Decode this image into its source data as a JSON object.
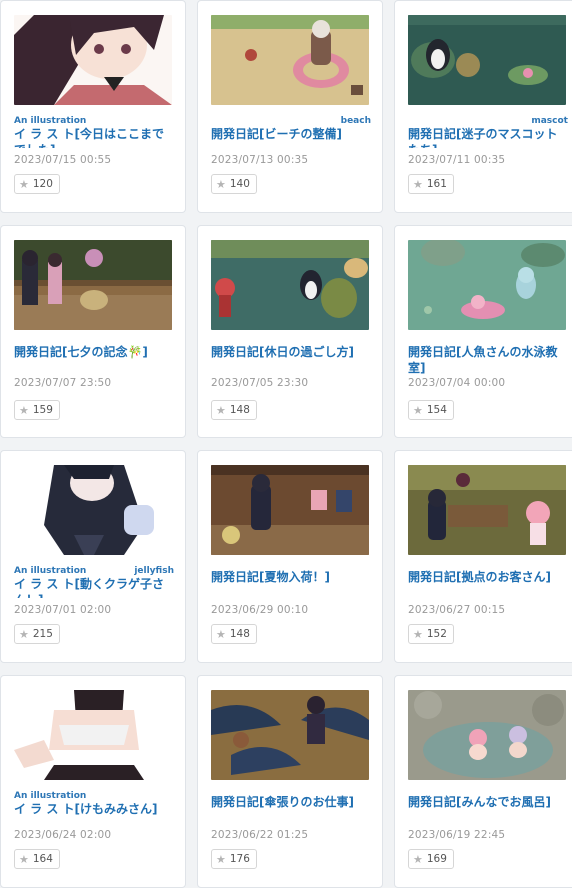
{
  "cards": [
    {
      "subtitle_left": "An illustration",
      "subtitle_right": "",
      "title": "イ ラ ス ト[今日はここまででした]",
      "date": "2023/07/15 00:55",
      "likes": "120",
      "thumb": "girl-portrait"
    },
    {
      "subtitle_left": "",
      "subtitle_right": "beach",
      "title": "開発日記[ビーチの整備]",
      "date": "2023/07/13 00:35",
      "likes": "140",
      "thumb": "beach"
    },
    {
      "subtitle_left": "",
      "subtitle_right": "mascot",
      "title": "開発日記[迷子のマスコットたち]",
      "date": "2023/07/11 00:35",
      "likes": "161",
      "thumb": "pond-mascot"
    },
    {
      "subtitle_left": "",
      "subtitle_right": "",
      "title": "開発日記[七夕の記念🎋]",
      "date": "2023/07/07 23:50",
      "likes": "159",
      "thumb": "tanabata"
    },
    {
      "subtitle_left": "",
      "subtitle_right": "",
      "title": "開発日記[休日の過ごし方]",
      "date": "2023/07/05 23:30",
      "likes": "148",
      "thumb": "holiday"
    },
    {
      "subtitle_left": "",
      "subtitle_right": "",
      "title": "開発日記[人魚さんの水泳教室]",
      "date": "2023/07/04 00:00",
      "likes": "154",
      "thumb": "mermaid"
    },
    {
      "subtitle_left": "An illustration",
      "subtitle_right": "jellyfish",
      "title": "イ ラ ス ト[動くクラゲ子さん！]",
      "date": "2023/07/01 02:00",
      "likes": "215",
      "thumb": "jellyfish"
    },
    {
      "subtitle_left": "",
      "subtitle_right": "",
      "title": "開発日記[夏物入荷！]",
      "date": "2023/06/29 00:10",
      "likes": "148",
      "thumb": "shop"
    },
    {
      "subtitle_left": "",
      "subtitle_right": "",
      "title": "開発日記[拠点のお客さん]",
      "date": "2023/06/27 00:15",
      "likes": "152",
      "thumb": "base-guests"
    },
    {
      "subtitle_left": "An illustration",
      "subtitle_right": "",
      "title": "イ ラ ス ト[けもみみさん]",
      "date": "2023/06/24 02:00",
      "likes": "164",
      "thumb": "kemomimi"
    },
    {
      "subtitle_left": "",
      "subtitle_right": "",
      "title": "開発日記[傘張りのお仕事]",
      "date": "2023/06/22 01:25",
      "likes": "176",
      "thumb": "umbrellas"
    },
    {
      "subtitle_left": "",
      "subtitle_right": "",
      "title": "開発日記[みんなでお風呂]",
      "date": "2023/06/19 22:45",
      "likes": "169",
      "thumb": "bath"
    }
  ]
}
